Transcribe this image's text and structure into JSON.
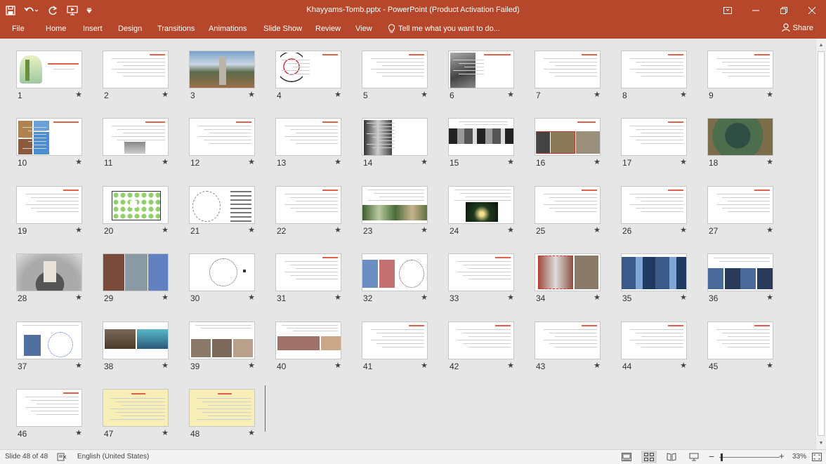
{
  "app": {
    "title": "Khayyams-Tomb.pptx  -  PowerPoint (Product Activation Failed)",
    "accent": "#b7472a"
  },
  "quick_access": [
    {
      "name": "save-icon"
    },
    {
      "name": "undo-icon"
    },
    {
      "name": "redo-icon"
    },
    {
      "name": "start-from-beginning-icon"
    },
    {
      "name": "customize-toolbar-icon"
    }
  ],
  "window_controls": [
    "ribbon-display-options-icon",
    "minimize-icon",
    "maximize-icon",
    "close-icon"
  ],
  "ribbon": {
    "tabs": [
      {
        "label": "File",
        "id": "file"
      },
      {
        "label": "Home",
        "id": "home"
      },
      {
        "label": "Insert",
        "id": "insert"
      },
      {
        "label": "Design",
        "id": "design"
      },
      {
        "label": "Transitions",
        "id": "transitions"
      },
      {
        "label": "Animations",
        "id": "animations"
      },
      {
        "label": "Slide Show",
        "id": "slide-show"
      },
      {
        "label": "Review",
        "id": "review"
      },
      {
        "label": "View",
        "id": "view"
      }
    ],
    "tell_me": "Tell me what you want to do...",
    "share": "Share"
  },
  "slides": [
    {
      "number": "1",
      "star": "★",
      "kind": "title"
    },
    {
      "number": "2",
      "star": "★",
      "kind": "text"
    },
    {
      "number": "3",
      "star": "★",
      "kind": "photo"
    },
    {
      "number": "4",
      "star": "★",
      "kind": "portrait"
    },
    {
      "number": "5",
      "star": "★",
      "kind": "text"
    },
    {
      "number": "6",
      "star": "★",
      "kind": "photo-left"
    },
    {
      "number": "7",
      "star": "★",
      "kind": "text"
    },
    {
      "number": "8",
      "star": "★",
      "kind": "text"
    },
    {
      "number": "9",
      "star": "★",
      "kind": "text"
    },
    {
      "number": "10",
      "star": "★",
      "kind": "collage-text"
    },
    {
      "number": "11",
      "star": "★",
      "kind": "text-photo"
    },
    {
      "number": "12",
      "star": "★",
      "kind": "text"
    },
    {
      "number": "13",
      "star": "★",
      "kind": "text"
    },
    {
      "number": "14",
      "star": "★",
      "kind": "photo-text"
    },
    {
      "number": "15",
      "star": "★",
      "kind": "photo-strip"
    },
    {
      "number": "16",
      "star": "★",
      "kind": "photos-red"
    },
    {
      "number": "17",
      "star": "★",
      "kind": "text"
    },
    {
      "number": "18",
      "star": "★",
      "kind": "aerial"
    },
    {
      "number": "19",
      "star": "★",
      "kind": "text"
    },
    {
      "number": "20",
      "star": "★",
      "kind": "site-plan"
    },
    {
      "number": "21",
      "star": "★",
      "kind": "drawing"
    },
    {
      "number": "22",
      "star": "★",
      "kind": "text"
    },
    {
      "number": "23",
      "star": "★",
      "kind": "text-photos"
    },
    {
      "number": "24",
      "star": "★",
      "kind": "text-night"
    },
    {
      "number": "25",
      "star": "★",
      "kind": "text"
    },
    {
      "number": "26",
      "star": "★",
      "kind": "text"
    },
    {
      "number": "27",
      "star": "★",
      "kind": "text"
    },
    {
      "number": "28",
      "star": "★",
      "kind": "model"
    },
    {
      "number": "29",
      "star": "★",
      "kind": "photos-3"
    },
    {
      "number": "30",
      "star": "★",
      "kind": "plan"
    },
    {
      "number": "31",
      "star": "★",
      "kind": "text"
    },
    {
      "number": "32",
      "star": "★",
      "kind": "photos-plan"
    },
    {
      "number": "33",
      "star": "★",
      "kind": "text"
    },
    {
      "number": "34",
      "star": "★",
      "kind": "photos-dashed"
    },
    {
      "number": "35",
      "star": "★",
      "kind": "photos-blue"
    },
    {
      "number": "36",
      "star": "★",
      "kind": "tiles"
    },
    {
      "number": "37",
      "star": "★",
      "kind": "photo-plan"
    },
    {
      "number": "38",
      "star": "★",
      "kind": "photos-2"
    },
    {
      "number": "39",
      "star": "★",
      "kind": "photos-3b"
    },
    {
      "number": "40",
      "star": "★",
      "kind": "text-photos-b"
    },
    {
      "number": "41",
      "star": "★",
      "kind": "text"
    },
    {
      "number": "42",
      "star": "★",
      "kind": "text"
    },
    {
      "number": "43",
      "star": "★",
      "kind": "text"
    },
    {
      "number": "44",
      "star": "★",
      "kind": "text"
    },
    {
      "number": "45",
      "star": "★",
      "kind": "text"
    },
    {
      "number": "46",
      "star": "★",
      "kind": "text"
    },
    {
      "number": "47",
      "star": "★",
      "kind": "yellow"
    },
    {
      "number": "48",
      "star": "★",
      "kind": "yellow"
    }
  ],
  "status": {
    "slide_info": "Slide 48 of 48",
    "language": "English (United States)",
    "zoom": "33%",
    "zoom_out": "−",
    "zoom_in": "+",
    "active_view": "slide-sorter"
  }
}
